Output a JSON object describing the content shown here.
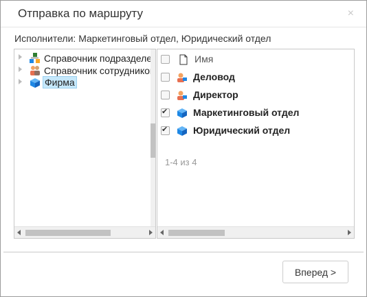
{
  "dialog": {
    "title": "Отправка по маршруту",
    "close_icon": "×",
    "executors_label": "Исполнители: Маркетинговый отдел, Юридический отдел"
  },
  "tree": {
    "items": [
      {
        "label": "Справочник подразделений",
        "icon": "org-units-icon",
        "expanded": false
      },
      {
        "label": "Справочник сотрудников",
        "icon": "employees-icon",
        "expanded": false
      },
      {
        "label": "Фирма",
        "icon": "firm-cube-icon",
        "expanded": false,
        "selected": true
      }
    ]
  },
  "grid": {
    "header": "Имя",
    "rows": [
      {
        "label": "Деловод",
        "icon": "user-icon",
        "checked": false
      },
      {
        "label": "Директор",
        "icon": "user-icon",
        "checked": false
      },
      {
        "label": "Маркетинговый отдел",
        "icon": "department-cube-icon",
        "checked": true
      },
      {
        "label": "Юридический отдел",
        "icon": "department-cube-icon",
        "checked": true
      }
    ],
    "counter": "1-4 из 4"
  },
  "footer": {
    "next_label": "Вперед >"
  },
  "colors": {
    "selection_bg": "#c6e8fb",
    "cube_blue": "#1e88e5",
    "border": "#c8c8c8"
  }
}
